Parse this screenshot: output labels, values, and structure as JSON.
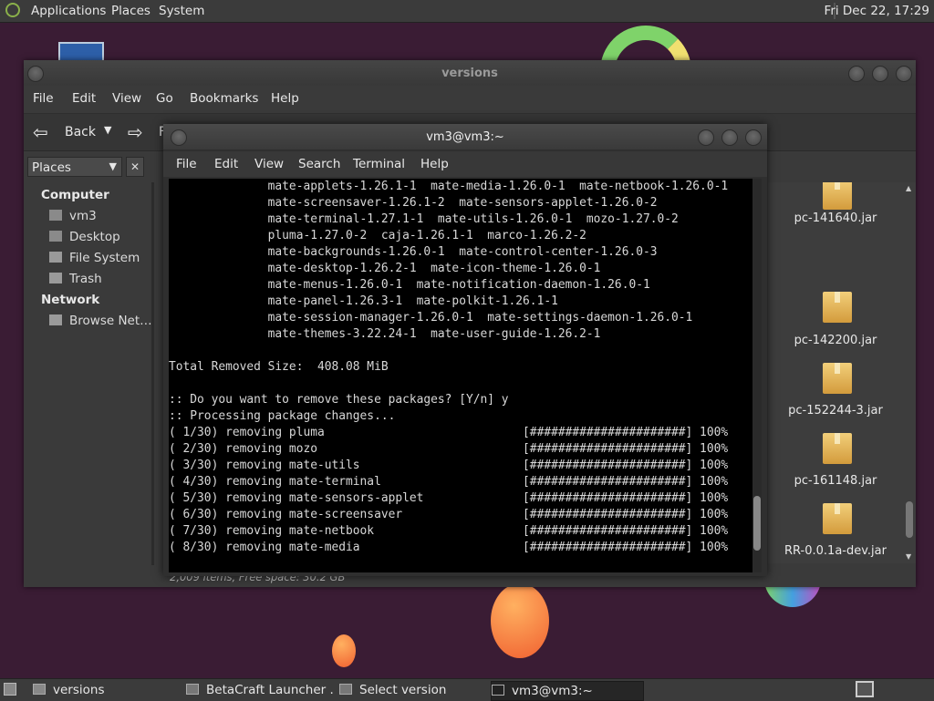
{
  "top_panel": {
    "applications": "Applications",
    "places": "Places",
    "system": "System",
    "clock": "Fri Dec 22, 17:29"
  },
  "file_manager": {
    "title": "versions",
    "menu": [
      "File",
      "Edit",
      "View",
      "Go",
      "Bookmarks",
      "Help"
    ],
    "toolbar": {
      "back": "Back",
      "forward": "F"
    },
    "places_combo": "Places",
    "sidebar": {
      "computer_heading": "Computer",
      "computer_items": [
        "vm3",
        "Desktop",
        "File System",
        "Trash"
      ],
      "network_heading": "Network",
      "network_items": [
        "Browse Net…"
      ]
    },
    "files": [
      "pc-141640.jar",
      "pc-142200.jar",
      "pc-152244-3.jar",
      "pc-161148.jar",
      "RR-0.0.1a-dev.jar"
    ],
    "status": "2,009 items, Free space: 30.2 GB"
  },
  "terminal": {
    "title": "vm3@vm3:~",
    "menu": [
      "File",
      "Edit",
      "View",
      "Search",
      "Terminal",
      "Help"
    ],
    "lines": [
      "              mate-applets-1.26.1-1  mate-media-1.26.0-1  mate-netbook-1.26.0-1",
      "              mate-screensaver-1.26.1-2  mate-sensors-applet-1.26.0-2",
      "              mate-terminal-1.27.1-1  mate-utils-1.26.0-1  mozo-1.27.0-2",
      "              pluma-1.27.0-2  caja-1.26.1-1  marco-1.26.2-2",
      "              mate-backgrounds-1.26.0-1  mate-control-center-1.26.0-3",
      "              mate-desktop-1.26.2-1  mate-icon-theme-1.26.0-1",
      "              mate-menus-1.26.0-1  mate-notification-daemon-1.26.0-1",
      "              mate-panel-1.26.3-1  mate-polkit-1.26.1-1",
      "              mate-session-manager-1.26.0-1  mate-settings-daemon-1.26.0-1",
      "              mate-themes-3.22.24-1  mate-user-guide-1.26.2-1",
      "",
      "Total Removed Size:  408.08 MiB",
      "",
      ":: Do you want to remove these packages? [Y/n] y",
      ":: Processing package changes...",
      "( 1/30) removing pluma                            [######################] 100%",
      "( 2/30) removing mozo                             [######################] 100%",
      "( 3/30) removing mate-utils                       [######################] 100%",
      "( 4/30) removing mate-terminal                    [######################] 100%",
      "( 5/30) removing mate-sensors-applet              [######################] 100%",
      "( 6/30) removing mate-screensaver                 [######################] 100%",
      "( 7/30) removing mate-netbook                     [######################] 100%",
      "( 8/30) removing mate-media                       [######################] 100%"
    ]
  },
  "taskbar": {
    "tasks": [
      "versions",
      "BetaCraft Launcher ...",
      "Select version",
      "vm3@vm3:~"
    ]
  }
}
